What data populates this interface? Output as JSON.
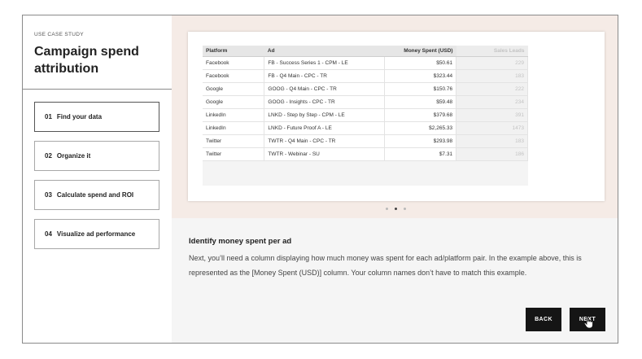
{
  "sidebar": {
    "eyebrow": "USE CASE STUDY",
    "title": "Campaign spend attribution",
    "steps": [
      {
        "number": "01",
        "label": "Find your data",
        "active": true
      },
      {
        "number": "02",
        "label": "Organize it",
        "active": false
      },
      {
        "number": "03",
        "label": "Calculate spend and ROI",
        "active": false
      },
      {
        "number": "04",
        "label": "Visualize ad performance",
        "active": false
      }
    ]
  },
  "table": {
    "headers": [
      "Platform",
      "Ad",
      "Money Spent (USD)",
      "Sales Leads"
    ],
    "rows": [
      [
        "Facebook",
        "FB - Success Series 1 - CPM - LE",
        "$50.61",
        "229"
      ],
      [
        "Facebook",
        "FB - Q4 Main - CPC - TR",
        "$323.44",
        "183"
      ],
      [
        "Google",
        "GOOG - Q4 Main - CPC - TR",
        "$150.76",
        "222"
      ],
      [
        "Google",
        "GOOG - Insights - CPC - TR",
        "$59.48",
        "234"
      ],
      [
        "LinkedIn",
        "LNKD - Step by Step - CPM - LE",
        "$379.68",
        "391"
      ],
      [
        "LinkedIn",
        "LNKD - Future Proof A - LE",
        "$2,265.33",
        "1473"
      ],
      [
        "Twitter",
        "TWTR - Q4 Main - CPC - TR",
        "$293.98",
        "183"
      ],
      [
        "Twitter",
        "TWTR - Webinar - SU",
        "$7.31",
        "186"
      ]
    ]
  },
  "carousel": {
    "active_index": 1,
    "count": 3
  },
  "description": {
    "title": "Identify money spent per ad",
    "body": "Next, you’ll need a column displaying how much money was spent for each ad/platform pair. In the example above, this is represented as the [Money Spent (USD)] column. Your column names don’t have to match this example."
  },
  "buttons": {
    "back": "BACK",
    "next": "NEXT"
  },
  "colors": {
    "accent_bg": "#f5ebe6",
    "button_bg": "#151515",
    "panel_bg": "#f5f5f5"
  }
}
